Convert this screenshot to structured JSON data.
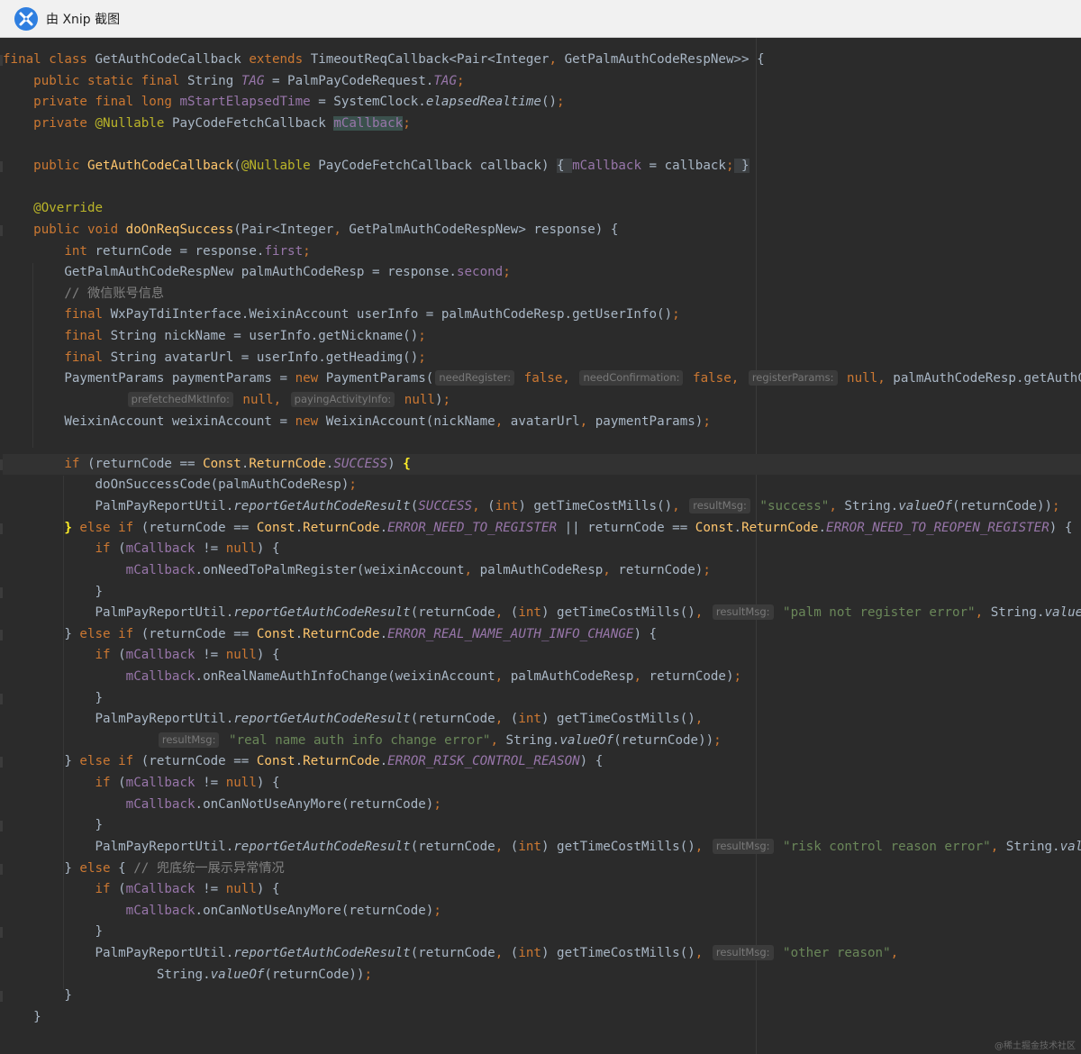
{
  "window": {
    "title": "由 Xnip 截图",
    "icon": "xnip-logo-icon"
  },
  "watermark": "@稀土掘金技术社区",
  "colors": {
    "background": "#2b2b2b",
    "keyword": "#cc7832",
    "string": "#6a8759",
    "field": "#9876aa",
    "method": "#ffc66d",
    "comment": "#808080",
    "annotation": "#bbb529"
  },
  "code": {
    "lines": [
      [
        [
          "kw",
          "final class "
        ],
        [
          "pl",
          "GetAuthCodeCallback "
        ],
        [
          "kw",
          "extends "
        ],
        [
          "pl",
          "TimeoutReqCallback<Pair<Integer"
        ],
        [
          "kw",
          ", "
        ],
        [
          "pl",
          "GetPalmAuthCodeRespNew>> {"
        ]
      ],
      [
        [
          "pl",
          "    "
        ],
        [
          "kw",
          "public static final "
        ],
        [
          "pl",
          "String "
        ],
        [
          "fdi",
          "TAG"
        ],
        [
          "pl",
          " = PalmPayCodeRequest."
        ],
        [
          "fdi",
          "TAG"
        ],
        [
          "kw",
          ";"
        ]
      ],
      [
        [
          "pl",
          "    "
        ],
        [
          "kw",
          "private final long "
        ],
        [
          "fd",
          "mStartElapsedTime"
        ],
        [
          "pl",
          " = SystemClock."
        ],
        [
          "it",
          "elapsedRealtime"
        ],
        [
          "pl",
          "()"
        ],
        [
          "kw",
          ";"
        ]
      ],
      [
        [
          "pl",
          "    "
        ],
        [
          "kw",
          "private "
        ],
        [
          "an",
          "@Nullable "
        ],
        [
          "pl",
          "PayCodeFetchCallback "
        ],
        [
          "hl",
          "mCallback"
        ],
        [
          "kw",
          ";"
        ]
      ],
      [],
      [
        [
          "pl",
          "    "
        ],
        [
          "kw",
          "public "
        ],
        [
          "fn",
          "GetAuthCodeCallback"
        ],
        [
          "pl",
          "("
        ],
        [
          "an",
          "@Nullable "
        ],
        [
          "pl",
          "PayCodeFetchCallback callback) "
        ],
        [
          "fold",
          "{ "
        ],
        [
          "fd",
          "mCallback"
        ],
        [
          "pl",
          " = callback"
        ],
        [
          "kw",
          ";"
        ],
        [
          "fold",
          " }"
        ]
      ],
      [],
      [
        [
          "pl",
          "    "
        ],
        [
          "an",
          "@Override"
        ]
      ],
      [
        [
          "pl",
          "    "
        ],
        [
          "kw",
          "public void "
        ],
        [
          "fn",
          "doOnReqSuccess"
        ],
        [
          "pl",
          "(Pair<Integer"
        ],
        [
          "kw",
          ", "
        ],
        [
          "pl",
          "GetPalmAuthCodeRespNew> response) {"
        ]
      ],
      [
        [
          "pl",
          "        "
        ],
        [
          "kw",
          "int "
        ],
        [
          "pl",
          "returnCode = response."
        ],
        [
          "fd",
          "first"
        ],
        [
          "kw",
          ";"
        ]
      ],
      [
        [
          "pl",
          "        GetPalmAuthCodeRespNew palmAuthCodeResp = response."
        ],
        [
          "fd",
          "second"
        ],
        [
          "kw",
          ";"
        ]
      ],
      [
        [
          "pl",
          "        "
        ],
        [
          "cm",
          "// 微信账号信息"
        ]
      ],
      [
        [
          "pl",
          "        "
        ],
        [
          "kw",
          "final "
        ],
        [
          "pl",
          "WxPayTdiInterface.WeixinAccount userInfo = palmAuthCodeResp.getUserInfo()"
        ],
        [
          "kw",
          ";"
        ]
      ],
      [
        [
          "pl",
          "        "
        ],
        [
          "kw",
          "final "
        ],
        [
          "pl",
          "String nickName = userInfo.getNickname()"
        ],
        [
          "kw",
          ";"
        ]
      ],
      [
        [
          "pl",
          "        "
        ],
        [
          "kw",
          "final "
        ],
        [
          "pl",
          "String avatarUrl = userInfo.getHeadimg()"
        ],
        [
          "kw",
          ";"
        ]
      ],
      [
        [
          "pl",
          "        PaymentParams paymentParams = "
        ],
        [
          "kw",
          "new "
        ],
        [
          "pl",
          "PaymentParams("
        ],
        [
          "hint",
          "needRegister:"
        ],
        [
          "kw",
          " false, "
        ],
        [
          "hint",
          "needConfirmation:"
        ],
        [
          "kw",
          " false, "
        ],
        [
          "hint",
          "registerParams:"
        ],
        [
          "kw",
          " null, "
        ],
        [
          "pl",
          "palmAuthCodeResp.getAuthCode("
        ]
      ],
      [
        [
          "pl",
          "                "
        ],
        [
          "hint",
          "prefetchedMktInfo:"
        ],
        [
          "kw",
          " null, "
        ],
        [
          "hint",
          "payingActivityInfo:"
        ],
        [
          "kw",
          " null"
        ],
        [
          "pl",
          ")"
        ],
        [
          "kw",
          ";"
        ]
      ],
      [
        [
          "pl",
          "        WeixinAccount weixinAccount = "
        ],
        [
          "kw",
          "new "
        ],
        [
          "pl",
          "WeixinAccount(nickName"
        ],
        [
          "kw",
          ", "
        ],
        [
          "pl",
          "avatarUrl"
        ],
        [
          "kw",
          ", "
        ],
        [
          "pl",
          "paymentParams)"
        ],
        [
          "kw",
          ";"
        ]
      ],
      [],
      [
        [
          "pl",
          "        "
        ],
        [
          "kw",
          "if "
        ],
        [
          "pl",
          "(returnCode == "
        ],
        [
          "fn",
          "Const"
        ],
        [
          "pl",
          "."
        ],
        [
          "fn",
          "ReturnCode"
        ],
        [
          "pl",
          "."
        ],
        [
          "fdi",
          "SUCCESS"
        ],
        [
          "pl",
          ") "
        ],
        [
          "brace",
          "{"
        ]
      ],
      [
        [
          "pl",
          "            doOnSuccessCode(palmAuthCodeResp)"
        ],
        [
          "kw",
          ";"
        ]
      ],
      [
        [
          "pl",
          "            PalmPayReportUtil."
        ],
        [
          "it",
          "reportGetAuthCodeResult"
        ],
        [
          "pl",
          "("
        ],
        [
          "fdi",
          "SUCCESS"
        ],
        [
          "kw",
          ", "
        ],
        [
          "pl",
          "("
        ],
        [
          "kw",
          "int"
        ],
        [
          "pl",
          ") getTimeCostMills()"
        ],
        [
          "kw",
          ", "
        ],
        [
          "hint",
          "resultMsg:"
        ],
        [
          "st",
          " \"success\""
        ],
        [
          "kw",
          ", "
        ],
        [
          "pl",
          "String."
        ],
        [
          "it",
          "valueOf"
        ],
        [
          "pl",
          "(returnCode))"
        ],
        [
          "kw",
          ";"
        ]
      ],
      [
        [
          "pl",
          "        "
        ],
        [
          "brace",
          "}"
        ],
        [
          "kw",
          " else if "
        ],
        [
          "pl",
          "(returnCode == "
        ],
        [
          "fn",
          "Const"
        ],
        [
          "pl",
          "."
        ],
        [
          "fn",
          "ReturnCode"
        ],
        [
          "pl",
          "."
        ],
        [
          "fdi",
          "ERROR_NEED_TO_REGISTER"
        ],
        [
          "pl",
          " || returnCode == "
        ],
        [
          "fn",
          "Const"
        ],
        [
          "pl",
          "."
        ],
        [
          "fn",
          "ReturnCode"
        ],
        [
          "pl",
          "."
        ],
        [
          "fdi",
          "ERROR_NEED_TO_REOPEN_REGISTER"
        ],
        [
          "pl",
          ") {"
        ]
      ],
      [
        [
          "pl",
          "            "
        ],
        [
          "kw",
          "if "
        ],
        [
          "pl",
          "("
        ],
        [
          "fd",
          "mCallback"
        ],
        [
          "pl",
          " != "
        ],
        [
          "kw",
          "null"
        ],
        [
          "pl",
          ") {"
        ]
      ],
      [
        [
          "pl",
          "                "
        ],
        [
          "fd",
          "mCallback"
        ],
        [
          "pl",
          ".onNeedToPalmRegister(weixinAccount"
        ],
        [
          "kw",
          ", "
        ],
        [
          "pl",
          "palmAuthCodeResp"
        ],
        [
          "kw",
          ", "
        ],
        [
          "pl",
          "returnCode)"
        ],
        [
          "kw",
          ";"
        ]
      ],
      [
        [
          "pl",
          "            }"
        ]
      ],
      [
        [
          "pl",
          "            PalmPayReportUtil."
        ],
        [
          "it",
          "reportGetAuthCodeResult"
        ],
        [
          "pl",
          "(returnCode"
        ],
        [
          "kw",
          ", "
        ],
        [
          "pl",
          "("
        ],
        [
          "kw",
          "int"
        ],
        [
          "pl",
          ") getTimeCostMills()"
        ],
        [
          "kw",
          ", "
        ],
        [
          "hint",
          "resultMsg:"
        ],
        [
          "st",
          " \"palm not register error\""
        ],
        [
          "kw",
          ", "
        ],
        [
          "pl",
          "String."
        ],
        [
          "it",
          "valueOf"
        ],
        [
          "pl",
          "("
        ]
      ],
      [
        [
          "pl",
          "        } "
        ],
        [
          "kw",
          "else if "
        ],
        [
          "pl",
          "(returnCode == "
        ],
        [
          "fn",
          "Const"
        ],
        [
          "pl",
          "."
        ],
        [
          "fn",
          "ReturnCode"
        ],
        [
          "pl",
          "."
        ],
        [
          "fdi",
          "ERROR_REAL_NAME_AUTH_INFO_CHANGE"
        ],
        [
          "pl",
          ") {"
        ]
      ],
      [
        [
          "pl",
          "            "
        ],
        [
          "kw",
          "if "
        ],
        [
          "pl",
          "("
        ],
        [
          "fd",
          "mCallback"
        ],
        [
          "pl",
          " != "
        ],
        [
          "kw",
          "null"
        ],
        [
          "pl",
          ") {"
        ]
      ],
      [
        [
          "pl",
          "                "
        ],
        [
          "fd",
          "mCallback"
        ],
        [
          "pl",
          ".onRealNameAuthInfoChange(weixinAccount"
        ],
        [
          "kw",
          ", "
        ],
        [
          "pl",
          "palmAuthCodeResp"
        ],
        [
          "kw",
          ", "
        ],
        [
          "pl",
          "returnCode)"
        ],
        [
          "kw",
          ";"
        ]
      ],
      [
        [
          "pl",
          "            }"
        ]
      ],
      [
        [
          "pl",
          "            PalmPayReportUtil."
        ],
        [
          "it",
          "reportGetAuthCodeResult"
        ],
        [
          "pl",
          "(returnCode"
        ],
        [
          "kw",
          ", "
        ],
        [
          "pl",
          "("
        ],
        [
          "kw",
          "int"
        ],
        [
          "pl",
          ") getTimeCostMills()"
        ],
        [
          "kw",
          ","
        ]
      ],
      [
        [
          "pl",
          "                    "
        ],
        [
          "hint",
          "resultMsg:"
        ],
        [
          "st",
          " \"real name auth info change error\""
        ],
        [
          "kw",
          ", "
        ],
        [
          "pl",
          "String."
        ],
        [
          "it",
          "valueOf"
        ],
        [
          "pl",
          "(returnCode))"
        ],
        [
          "kw",
          ";"
        ]
      ],
      [
        [
          "pl",
          "        } "
        ],
        [
          "kw",
          "else if "
        ],
        [
          "pl",
          "(returnCode == "
        ],
        [
          "fn",
          "Const"
        ],
        [
          "pl",
          "."
        ],
        [
          "fn",
          "ReturnCode"
        ],
        [
          "pl",
          "."
        ],
        [
          "fdi",
          "ERROR_RISK_CONTROL_REASON"
        ],
        [
          "pl",
          ") {"
        ]
      ],
      [
        [
          "pl",
          "            "
        ],
        [
          "kw",
          "if "
        ],
        [
          "pl",
          "("
        ],
        [
          "fd",
          "mCallback"
        ],
        [
          "pl",
          " != "
        ],
        [
          "kw",
          "null"
        ],
        [
          "pl",
          ") {"
        ]
      ],
      [
        [
          "pl",
          "                "
        ],
        [
          "fd",
          "mCallback"
        ],
        [
          "pl",
          ".onCanNotUseAnyMore(returnCode)"
        ],
        [
          "kw",
          ";"
        ]
      ],
      [
        [
          "pl",
          "            }"
        ]
      ],
      [
        [
          "pl",
          "            PalmPayReportUtil."
        ],
        [
          "it",
          "reportGetAuthCodeResult"
        ],
        [
          "pl",
          "(returnCode"
        ],
        [
          "kw",
          ", "
        ],
        [
          "pl",
          "("
        ],
        [
          "kw",
          "int"
        ],
        [
          "pl",
          ") getTimeCostMills()"
        ],
        [
          "kw",
          ", "
        ],
        [
          "hint",
          "resultMsg:"
        ],
        [
          "st",
          " \"risk control reason error\""
        ],
        [
          "kw",
          ", "
        ],
        [
          "pl",
          "String."
        ],
        [
          "it",
          "valueOf"
        ]
      ],
      [
        [
          "pl",
          "        } "
        ],
        [
          "kw",
          "else "
        ],
        [
          "pl",
          "{ "
        ],
        [
          "cm",
          "// 兜底统一展示异常情况"
        ]
      ],
      [
        [
          "pl",
          "            "
        ],
        [
          "kw",
          "if "
        ],
        [
          "pl",
          "("
        ],
        [
          "fd",
          "mCallback"
        ],
        [
          "pl",
          " != "
        ],
        [
          "kw",
          "null"
        ],
        [
          "pl",
          ") {"
        ]
      ],
      [
        [
          "pl",
          "                "
        ],
        [
          "fd",
          "mCallback"
        ],
        [
          "pl",
          ".onCanNotUseAnyMore(returnCode)"
        ],
        [
          "kw",
          ";"
        ]
      ],
      [
        [
          "pl",
          "            }"
        ]
      ],
      [
        [
          "pl",
          "            PalmPayReportUtil."
        ],
        [
          "it",
          "reportGetAuthCodeResult"
        ],
        [
          "pl",
          "(returnCode"
        ],
        [
          "kw",
          ", "
        ],
        [
          "pl",
          "("
        ],
        [
          "kw",
          "int"
        ],
        [
          "pl",
          ") getTimeCostMills()"
        ],
        [
          "kw",
          ", "
        ],
        [
          "hint",
          "resultMsg:"
        ],
        [
          "st",
          " \"other reason\""
        ],
        [
          "kw",
          ","
        ]
      ],
      [
        [
          "pl",
          "                    String."
        ],
        [
          "it",
          "valueOf"
        ],
        [
          "pl",
          "(returnCode))"
        ],
        [
          "kw",
          ";"
        ]
      ],
      [
        [
          "pl",
          "        }"
        ]
      ],
      [
        [
          "pl",
          "    }"
        ]
      ]
    ]
  }
}
